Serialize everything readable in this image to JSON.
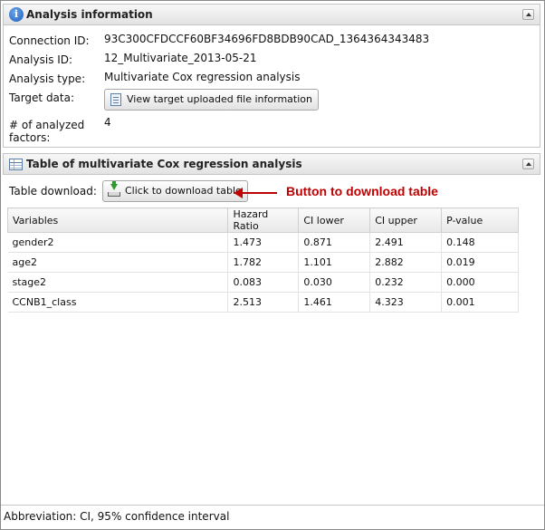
{
  "analysis_panel": {
    "title": "Analysis information",
    "connection_id_label": "Connection ID:",
    "connection_id_value": "93C300CFDCCF60BF34696FD8BDB90CAD_1364364343483",
    "analysis_id_label": "Analysis ID:",
    "analysis_id_value": "12_Multivariate_2013-05-21",
    "analysis_type_label": "Analysis type:",
    "analysis_type_value": "Multivariate Cox regression analysis",
    "target_data_label": "Target data:",
    "target_data_button": "View target uploaded file information",
    "analyzed_factors_label_line1": "# of analyzed",
    "analyzed_factors_label_line2": "factors:",
    "analyzed_factors_value": "4"
  },
  "table_panel": {
    "title": "Table of multivariate Cox regression analysis",
    "download_label": "Table download:",
    "download_button": "Click to download table",
    "annotation": "Button to download table",
    "columns": [
      "Variables",
      "Hazard Ratio",
      "CI lower",
      "CI upper",
      "P-value"
    ],
    "rows": [
      [
        "gender2",
        "1.473",
        "0.871",
        "2.491",
        "0.148"
      ],
      [
        "age2",
        "1.782",
        "1.101",
        "2.882",
        "0.019"
      ],
      [
        "stage2",
        "0.083",
        "0.030",
        "0.232",
        "0.000"
      ],
      [
        "CCNB1_class",
        "2.513",
        "1.461",
        "4.323",
        "0.001"
      ]
    ]
  },
  "footer": {
    "abbreviation": "Abbreviation: CI, 95% confidence interval"
  },
  "colors": {
    "annotation": "#c00000",
    "header_border": "#c5c5c5"
  },
  "icons": {
    "analysis_header": "info-icon",
    "table_header": "table-icon",
    "target_button": "document-icon",
    "download_button": "download-icon",
    "collapse": "chevron-up-icon",
    "annotation": "arrow-left-icon"
  }
}
